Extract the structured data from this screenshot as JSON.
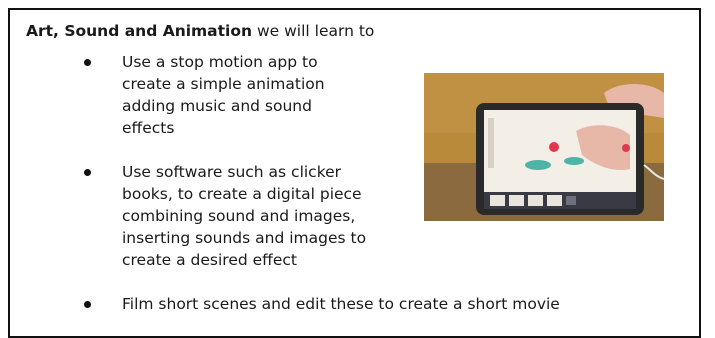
{
  "section": {
    "heading_bold": "Art, Sound and Animation",
    "heading_rest": " we will learn to"
  },
  "bullets": [
    {
      "text": "Use a stop motion app to create a simple animation adding music and sound effects"
    },
    {
      "text": "Use software such as clicker books, to create a digital piece combining sound and images, inserting sounds and images to create a desired effect"
    },
    {
      "text": "Film short scenes and edit these to create a short movie"
    }
  ],
  "image": {
    "subject": "child-using-tablet-stop-motion-app",
    "colors": {
      "wall": "#b98a3a",
      "table": "#8a6a3e",
      "tablet_frame": "#2a2a2a",
      "screen": "#f3efe6",
      "clay_teal": "#4fb3a6",
      "clay_red": "#e2364f",
      "hand": "#e7b7a8"
    }
  }
}
